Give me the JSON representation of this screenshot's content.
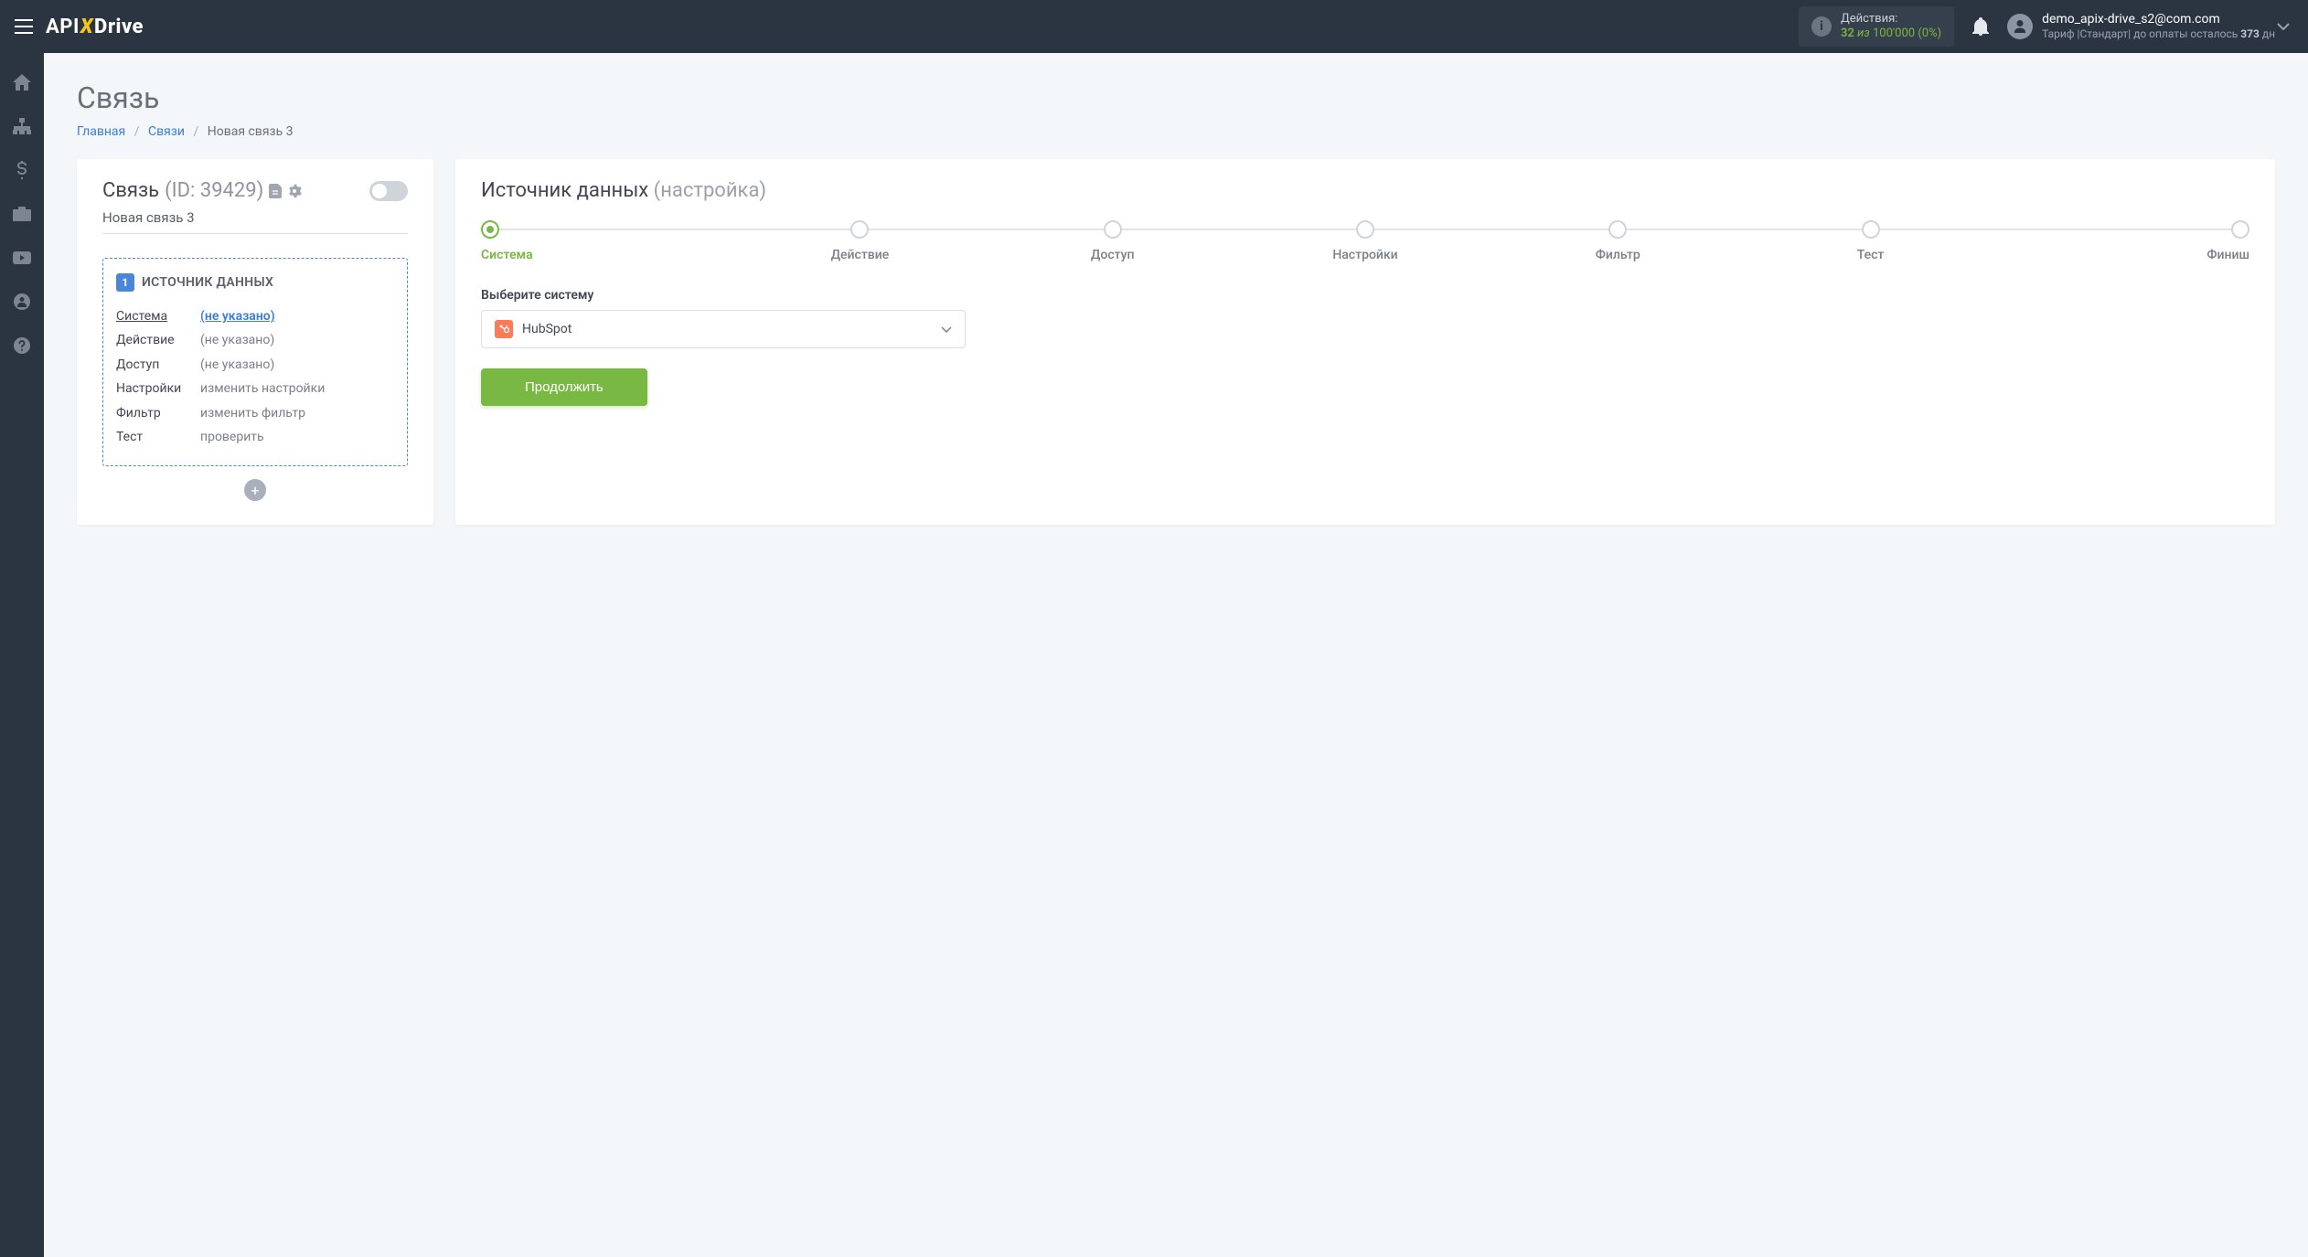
{
  "header": {
    "logo": {
      "api": "API",
      "x": "X",
      "drive": "Drive"
    },
    "actions": {
      "label": "Действия:",
      "used": "32",
      "of": "из",
      "limit": "100'000",
      "pct": "(0%)"
    },
    "user": {
      "email": "demo_apix-drive_s2@com.com",
      "plan_prefix": "Тариф |",
      "plan_name": "Стандарт",
      "plan_suffix": "| до оплаты осталось",
      "days": "373",
      "days_unit": "дн"
    }
  },
  "sidebar": {
    "items": [
      "home",
      "sitemap",
      "dollar",
      "briefcase",
      "youtube",
      "user",
      "help"
    ]
  },
  "page": {
    "title": "Связь",
    "breadcrumb": {
      "home": "Главная",
      "links": "Связи",
      "current": "Новая связь 3"
    }
  },
  "left": {
    "title": "Связь",
    "id_label": "(ID: 39429)",
    "name": "Новая связь 3",
    "source": {
      "badge": "1",
      "header": "ИСТОЧНИК ДАННЫХ",
      "rows": [
        {
          "label": "Система",
          "value": "(не указано)",
          "active": true
        },
        {
          "label": "Действие",
          "value": "(не указано)",
          "active": false
        },
        {
          "label": "Доступ",
          "value": "(не указано)",
          "active": false
        },
        {
          "label": "Настройки",
          "value": "изменить настройки",
          "active": false
        },
        {
          "label": "Фильтр",
          "value": "изменить фильтр",
          "active": false
        },
        {
          "label": "Тест",
          "value": "проверить",
          "active": false
        }
      ]
    }
  },
  "right": {
    "title": "Источник данных",
    "subtitle": "(настройка)",
    "steps": [
      {
        "label": "Система",
        "active": true
      },
      {
        "label": "Действие",
        "active": false
      },
      {
        "label": "Доступ",
        "active": false
      },
      {
        "label": "Настройки",
        "active": false
      },
      {
        "label": "Фильтр",
        "active": false
      },
      {
        "label": "Тест",
        "active": false
      },
      {
        "label": "Финиш",
        "active": false
      }
    ],
    "form": {
      "system_label": "Выберите систему",
      "system_value": "HubSpot",
      "continue": "Продолжить"
    }
  }
}
